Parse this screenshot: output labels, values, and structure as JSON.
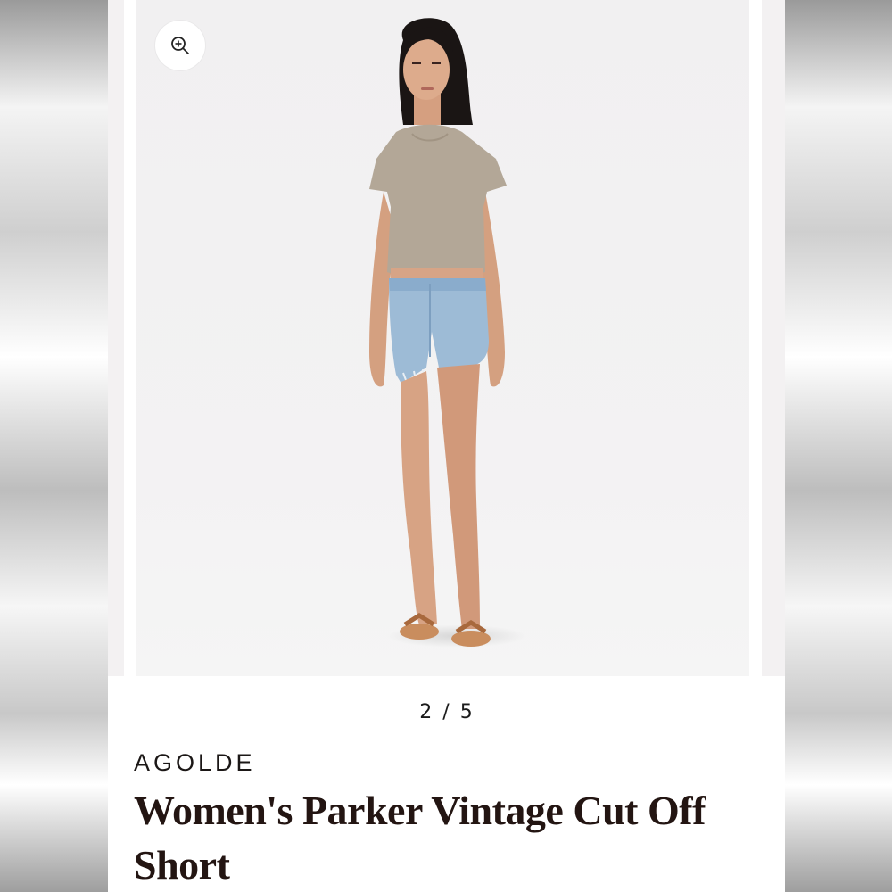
{
  "gallery": {
    "counter": "2 / 5",
    "zoom_icon": "zoom-in-icon",
    "image_description_icon": "model-photo"
  },
  "product": {
    "brand": "AGOLDE",
    "title": "Women's Parker Vintage Cut Off Short"
  },
  "colors": {
    "slide_background": "#f1f0f1",
    "title_text": "#231512",
    "top_color": "#b3a797",
    "shorts_color": "#9dbbd6",
    "sandals_color": "#c98d5e"
  }
}
